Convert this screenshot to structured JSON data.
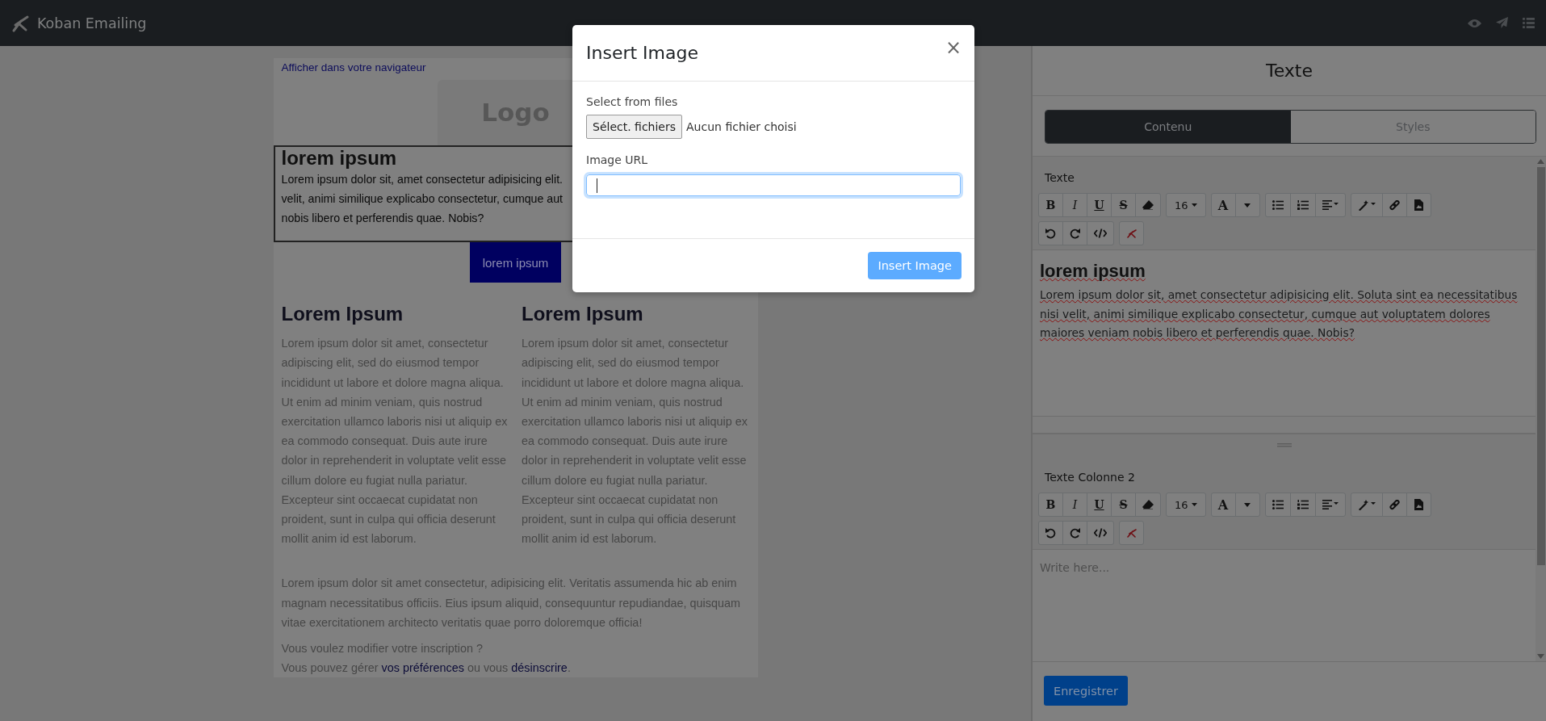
{
  "navbar": {
    "brand": "Koban Emailing"
  },
  "email": {
    "browser_link": "Afficher dans votre navigateur",
    "logo": "Logo",
    "block": {
      "heading": "lorem ipsum",
      "lines": [
        "Lorem ipsum dolor sit, amet consectetur adipisicing elit.",
        "velit, animi similique explicabo consectetur, cumque aut",
        "nobis libero et perferendis quae. Nobis?"
      ]
    },
    "button": "lorem ipsum",
    "columns": [
      {
        "heading": "Lorem Ipsum",
        "text": "Lorem ipsum dolor sit amet, consectetur adipiscing elit, sed do eiusmod tempor incididunt ut labore et dolore magna aliqua. Ut enim ad minim veniam, quis nostrud exercitation ullamco laboris nisi ut aliquip ex ea commodo consequat. Duis aute irure dolor in reprehenderit in voluptate velit esse cillum dolore eu fugiat nulla pariatur. Excepteur sint occaecat cupidatat non proident, sunt in culpa qui officia deserunt mollit anim id est laborum."
      },
      {
        "heading": "Lorem Ipsum",
        "text": "Lorem ipsum dolor sit amet, consectetur adipiscing elit, sed do eiusmod tempor incididunt ut labore et dolore magna aliqua. Ut enim ad minim veniam, quis nostrud exercitation ullamco laboris nisi ut aliquip ex ea commodo consequat. Duis aute irure dolor in reprehenderit in voluptate velit esse cillum dolore eu fugiat nulla pariatur. Excepteur sint occaecat cupidatat non proident, sunt in culpa qui officia deserunt mollit anim id est laborum."
      }
    ],
    "footer_text": "Lorem ipsum dolor sit amet consectetur, adipisicing elit. Veritatis assumenda hic ab enim magnam necessitatibus officiis. Eius ipsum aliquid, consequuntur repudiandae, quisquam vitae exercitationem architecto veritatis quae porro doloremque officia!",
    "subscription_question": "Vous voulez modifier votre inscription ?",
    "subscription_parts": [
      {
        "kind": "text",
        "text": "Vous pouvez gérer "
      },
      {
        "kind": "link",
        "text": "vos préférences"
      },
      {
        "kind": "text",
        "text": " ou vous "
      },
      {
        "kind": "link",
        "text": "désinscrire"
      },
      {
        "kind": "text",
        "text": "."
      }
    ]
  },
  "panel": {
    "title": "Texte",
    "tabs": [
      {
        "label": "Contenu",
        "selected": true
      },
      {
        "label": "Styles",
        "selected": false
      }
    ],
    "editors": [
      {
        "label": "Texte",
        "heading": "lorem ipsum",
        "text": "Lorem ipsum dolor sit, amet consectetur adipisicing elit. Soluta sint ea necessitatibus nisi velit, animi similique explicabo consectetur, cumque aut voluptatem dolores maiores veniam nobis libero et perferendis quae. Nobis?",
        "toolbar": [
          [
            [
              {
                "kind": "bold",
                "text": "B"
              },
              {
                "kind": "italic",
                "text": "I"
              },
              {
                "kind": "underline",
                "text": "U"
              },
              {
                "kind": "strike",
                "text": "S"
              },
              {
                "kind": "eraser"
              }
            ],
            [
              {
                "kind": "size",
                "text": "16"
              }
            ],
            [
              {
                "kind": "color",
                "text": "A"
              },
              {
                "kind": "caret"
              }
            ],
            [
              {
                "kind": "list-ul"
              },
              {
                "kind": "list-ol"
              },
              {
                "kind": "align"
              }
            ],
            [
              {
                "kind": "wand"
              },
              {
                "kind": "link"
              },
              {
                "kind": "file"
              }
            ]
          ],
          [
            [
              {
                "kind": "undo"
              },
              {
                "kind": "redo"
              },
              {
                "kind": "code"
              }
            ],
            [
              {
                "kind": "logo"
              }
            ]
          ]
        ]
      },
      {
        "label": "Texte Colonne 2",
        "placeholder": "Write here...",
        "toolbar": [
          [
            [
              {
                "kind": "bold",
                "text": "B"
              },
              {
                "kind": "italic",
                "text": "I"
              },
              {
                "kind": "underline",
                "text": "U"
              },
              {
                "kind": "strike",
                "text": "S"
              },
              {
                "kind": "eraser"
              }
            ],
            [
              {
                "kind": "size",
                "text": "16"
              }
            ],
            [
              {
                "kind": "color",
                "text": "A"
              },
              {
                "kind": "caret"
              }
            ],
            [
              {
                "kind": "list-ul"
              },
              {
                "kind": "list-ol"
              },
              {
                "kind": "align"
              }
            ],
            [
              {
                "kind": "wand"
              },
              {
                "kind": "link"
              },
              {
                "kind": "file"
              }
            ]
          ],
          [
            [
              {
                "kind": "undo"
              },
              {
                "kind": "redo"
              },
              {
                "kind": "code"
              }
            ],
            [
              {
                "kind": "logo"
              }
            ]
          ]
        ]
      }
    ],
    "save_button": "Enregistrer"
  },
  "modal": {
    "title": "Insert Image",
    "close": "×",
    "file_label": "Select from files",
    "file_button": "Sélect. fichiers",
    "file_status": "Aucun fichier choisi",
    "url_label": "Image URL",
    "submit": "Insert Image",
    "submit_disabled": true
  }
}
